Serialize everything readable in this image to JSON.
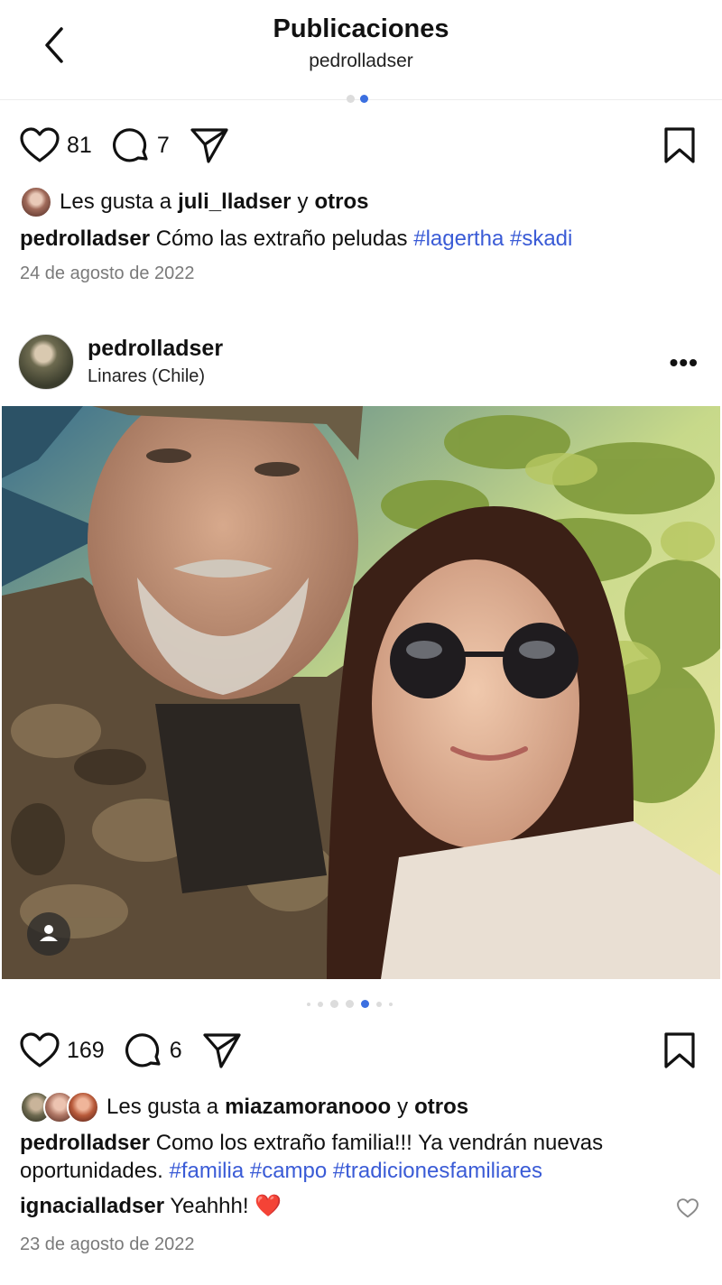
{
  "header": {
    "title": "Publicaciones",
    "subtitle": "pedrolladser"
  },
  "post1": {
    "likes_count": "81",
    "comments_count": "7",
    "liked_by_prefix": "Les gusta a",
    "liked_by_user": "juli_lladser",
    "liked_by_and": "y",
    "liked_by_others": "otros",
    "caption_user": "pedrolladser",
    "caption_text": "Cómo las extraño peludas",
    "hashtags": [
      "#lagertha",
      "#skadi"
    ],
    "date": "24 de agosto de 2022"
  },
  "post2": {
    "username": "pedrolladser",
    "location": "Linares (Chile)",
    "more_label": "•••",
    "photo_icon": "user-tag-icon",
    "likes_count": "169",
    "comments_count": "6",
    "liked_by_prefix": "Les gusta a",
    "liked_by_user": "miazamoranooo",
    "liked_by_and": "y",
    "liked_by_others": "otros",
    "caption_user": "pedrolladser",
    "caption_text": "Como los extraño familia!!! Ya vendrán nuevas oportunidades.",
    "hashtags": [
      "#familia",
      "#campo",
      "#tradicionesfamiliares"
    ],
    "comment_user": "ignacialladser",
    "comment_text": "Yeahhh!",
    "comment_emoji": "❤️",
    "date": "23 de agosto de 2022"
  },
  "colors": {
    "accent": "#3b6fe0",
    "hashtag": "#3a5bd6",
    "muted": "#7a7a7a",
    "heart_emoji": "#e0242e"
  }
}
